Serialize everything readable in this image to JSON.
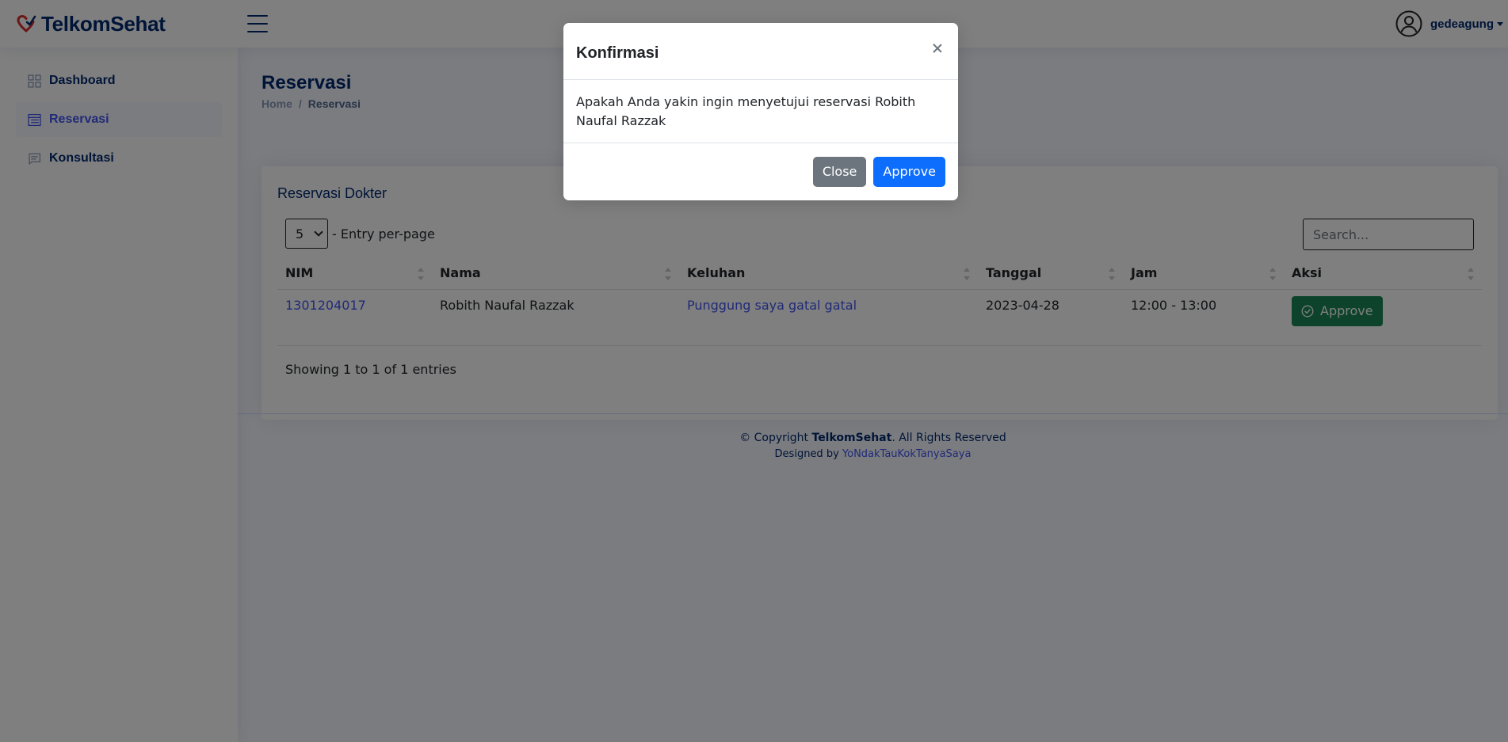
{
  "header": {
    "logo_text": "TelkomSehat",
    "username": "gedeagung"
  },
  "sidebar": {
    "items": [
      {
        "label": "Dashboard",
        "icon": "grid-icon",
        "active": false
      },
      {
        "label": "Reservasi",
        "icon": "list-icon",
        "active": true
      },
      {
        "label": "Konsultasi",
        "icon": "chat-icon",
        "active": false
      }
    ]
  },
  "page": {
    "title": "Reservasi",
    "breadcrumb": {
      "home": "Home",
      "sep": "/",
      "current": "Reservasi"
    }
  },
  "card": {
    "title": "Reservasi Dokter",
    "per_page_value": "5",
    "per_page_label": "- Entry per-page",
    "search_placeholder": "Search...",
    "columns": [
      "NIM",
      "Nama",
      "Keluhan",
      "Tanggal",
      "Jam",
      "Aksi"
    ],
    "rows": [
      {
        "nim": "1301204017",
        "nama": "Robith Naufal Razzak",
        "keluhan": "Punggung saya gatal gatal",
        "tanggal": "2023-04-28",
        "jam": "12:00 - 13:00",
        "aksi": "Approve"
      }
    ],
    "info": "Showing 1 to 1 of 1 entries"
  },
  "footer": {
    "copyright_prefix": "© Copyright",
    "brand": "TelkomSehat",
    "rights": ". All Rights Reserved",
    "designed_by": "Designed by",
    "designer": "YoNdakTauKokTanyaSaya"
  },
  "modal": {
    "title": "Konfirmasi",
    "body": "Apakah Anda yakin ingin menyetujui reservasi Robith Naufal Razzak",
    "close_label": "Close",
    "approve_label": "Approve"
  },
  "colors": {
    "brand": "#012970",
    "accent": "#4154f1",
    "success": "#198754",
    "primary": "#0d6efd",
    "secondary": "#6c757d"
  }
}
